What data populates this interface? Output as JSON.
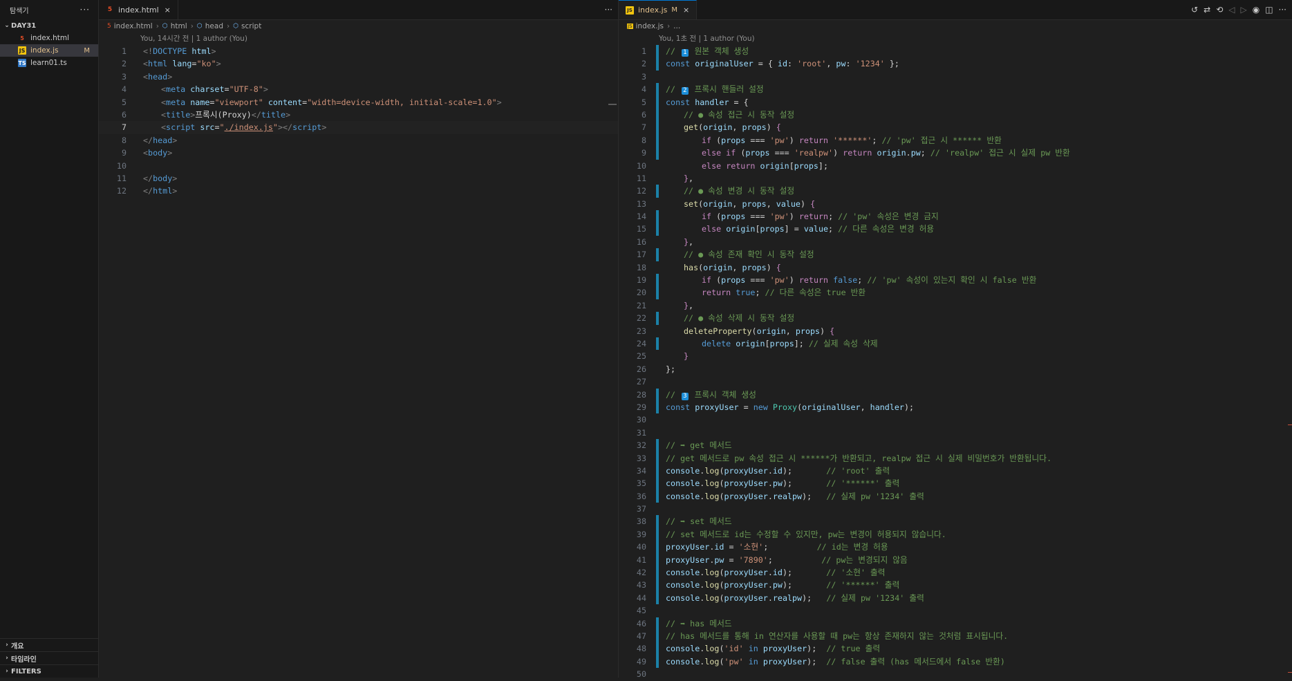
{
  "sidebar": {
    "title": "탐색기",
    "folder": "DAY31",
    "files": [
      {
        "name": "index.html",
        "type": "html",
        "badge": ""
      },
      {
        "name": "index.js",
        "type": "js",
        "badge": "M"
      },
      {
        "name": "learn01.ts",
        "type": "ts",
        "badge": ""
      }
    ],
    "sections": [
      "개요",
      "타임라인",
      "FILTERS"
    ]
  },
  "left_editor": {
    "tab": "index.html",
    "breadcrumb": [
      "index.html",
      "html",
      "head",
      "script"
    ],
    "blame": "You, 14시간 전 | 1 author (You)",
    "current_line": 7
  },
  "right_editor": {
    "tab": "index.js",
    "tab_badge": "M",
    "breadcrumb": [
      "index.js",
      "..."
    ],
    "blame": "You, 1초 전 | 1 author (You)"
  },
  "colors": {
    "accent": "#0078d4",
    "modified_gutter": "#1b81a8",
    "modified_text": "#e2c08d"
  }
}
